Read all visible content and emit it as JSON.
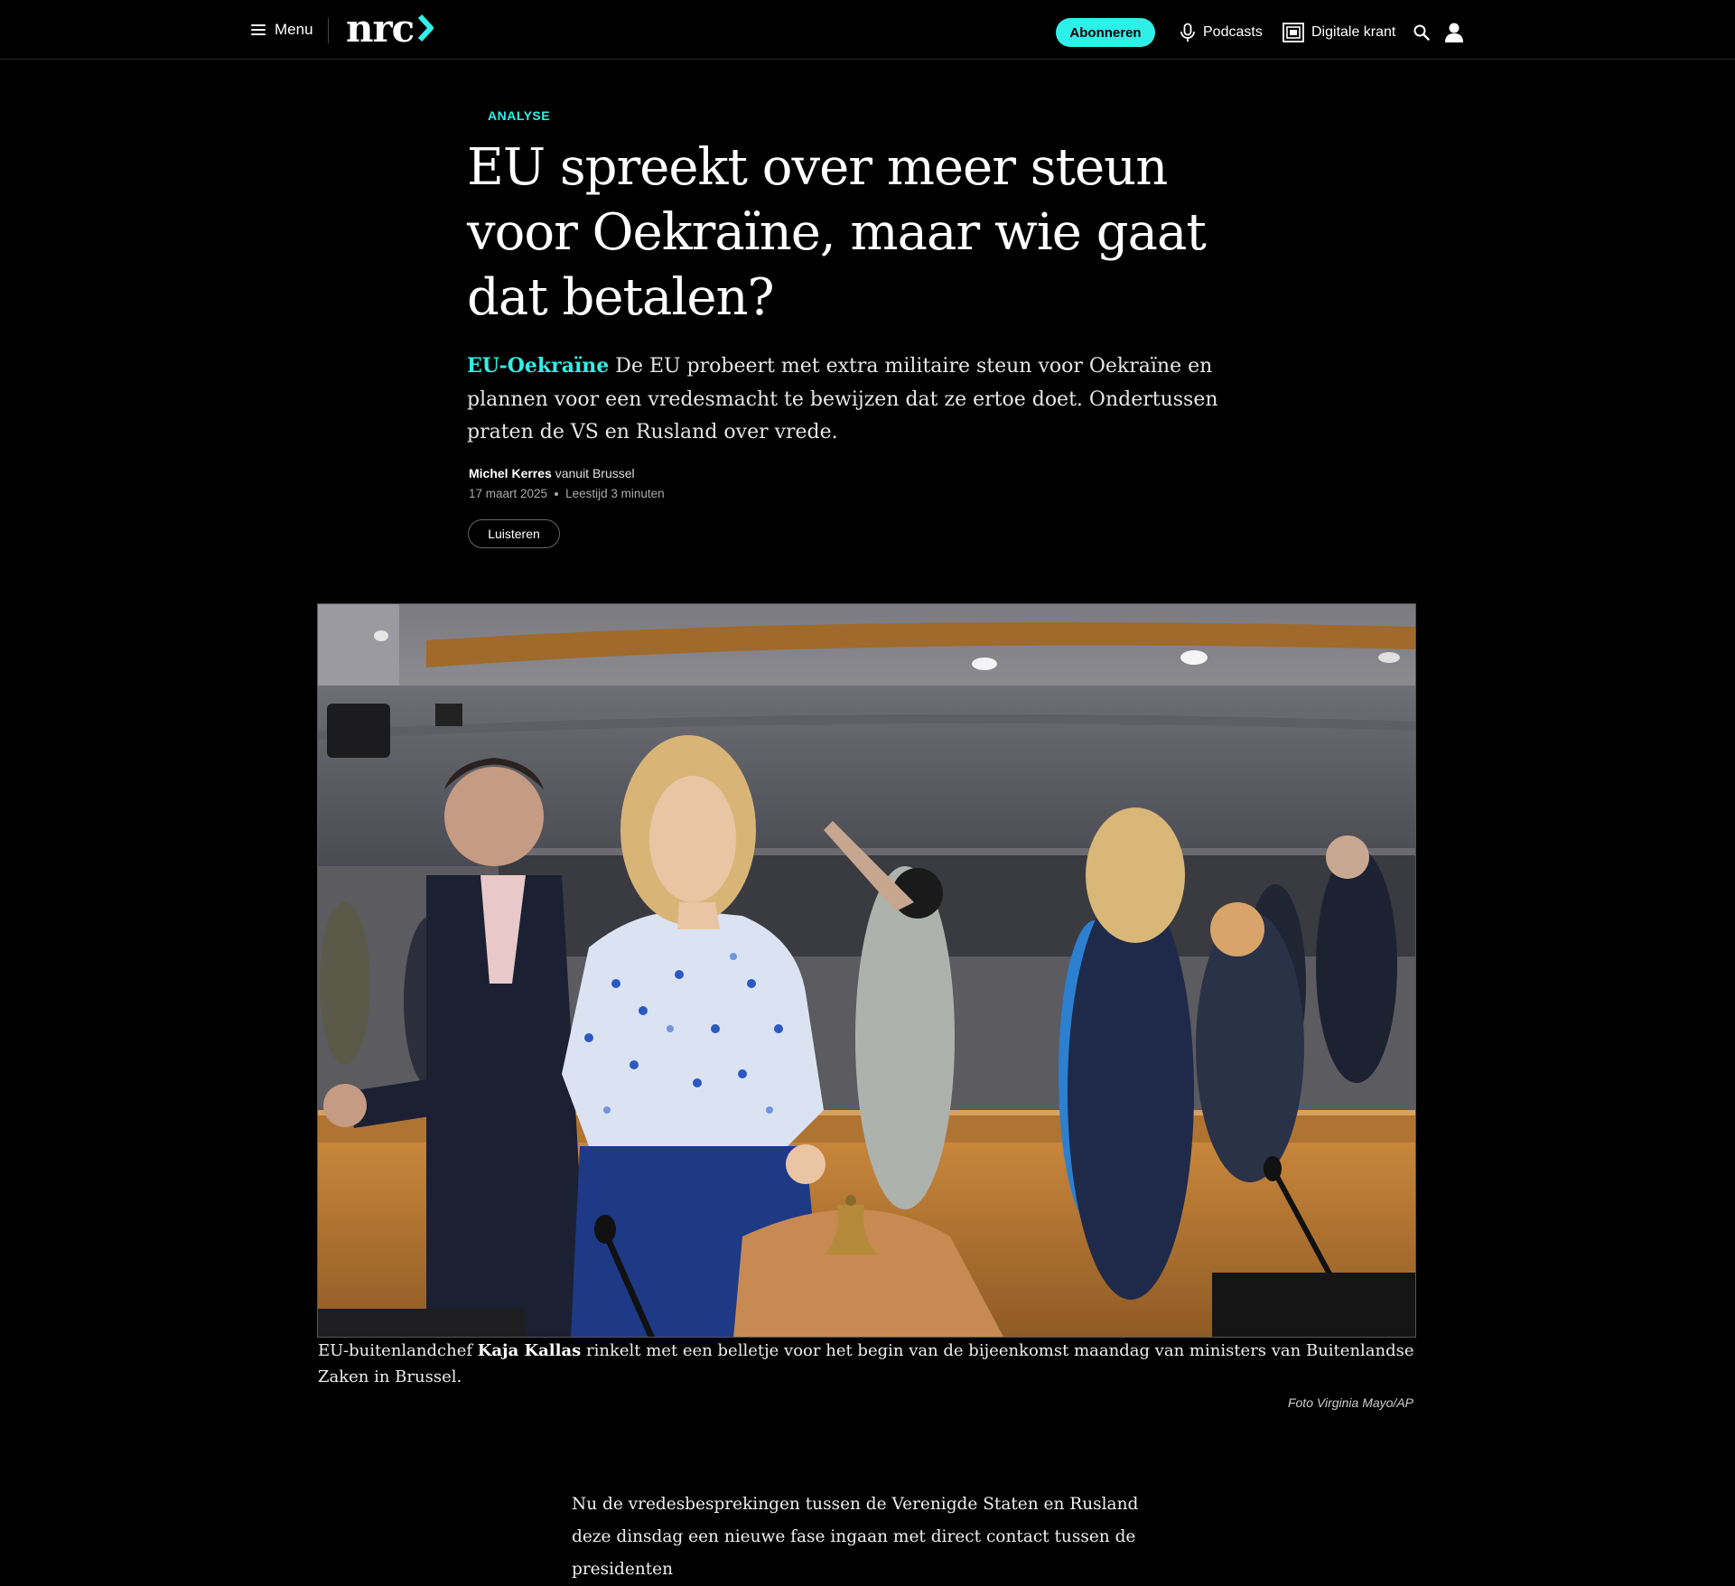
{
  "header": {
    "menu_label": "Menu",
    "logo_text": "nrc",
    "subscribe_label": "Abonneren",
    "podcasts_label": "Podcasts",
    "krant_label": "Digitale krant",
    "accent_color": "#2ff0e8"
  },
  "article": {
    "kicker": "ANALYSE",
    "headline": "EU spreekt over meer steun voor Oekraïne, maar wie gaat dat betalen?",
    "lead_tag": "EU-Oekraïne",
    "lead_text": " De EU probeert met extra militaire steun voor Oekraïne en plannen voor een vredesmacht te bewijzen dat ze ertoe doet. Ondertussen praten de VS en Rusland over vrede.",
    "author": "Michel Kerres",
    "location": " vanuit Brussel",
    "date": "17 maart 2025",
    "reading_time": "Leestijd 3 minuten",
    "listen_label": "Luisteren"
  },
  "photo": {
    "caption_before": "EU-buitenlandchef ",
    "caption_name": "Kaja Kallas",
    "caption_after": " rinkelt met een belletje voor het begin van de bijeenkomst maandag van ministers van Buitenlandse Zaken in Brussel.",
    "credit": "Foto Virginia Mayo/AP"
  },
  "body": {
    "paragraph": "Nu de vredesbesprekingen tussen de Verenigde Staten en Rusland deze dinsdag een nieuwe fase ingaan met direct contact tussen de presidenten"
  }
}
